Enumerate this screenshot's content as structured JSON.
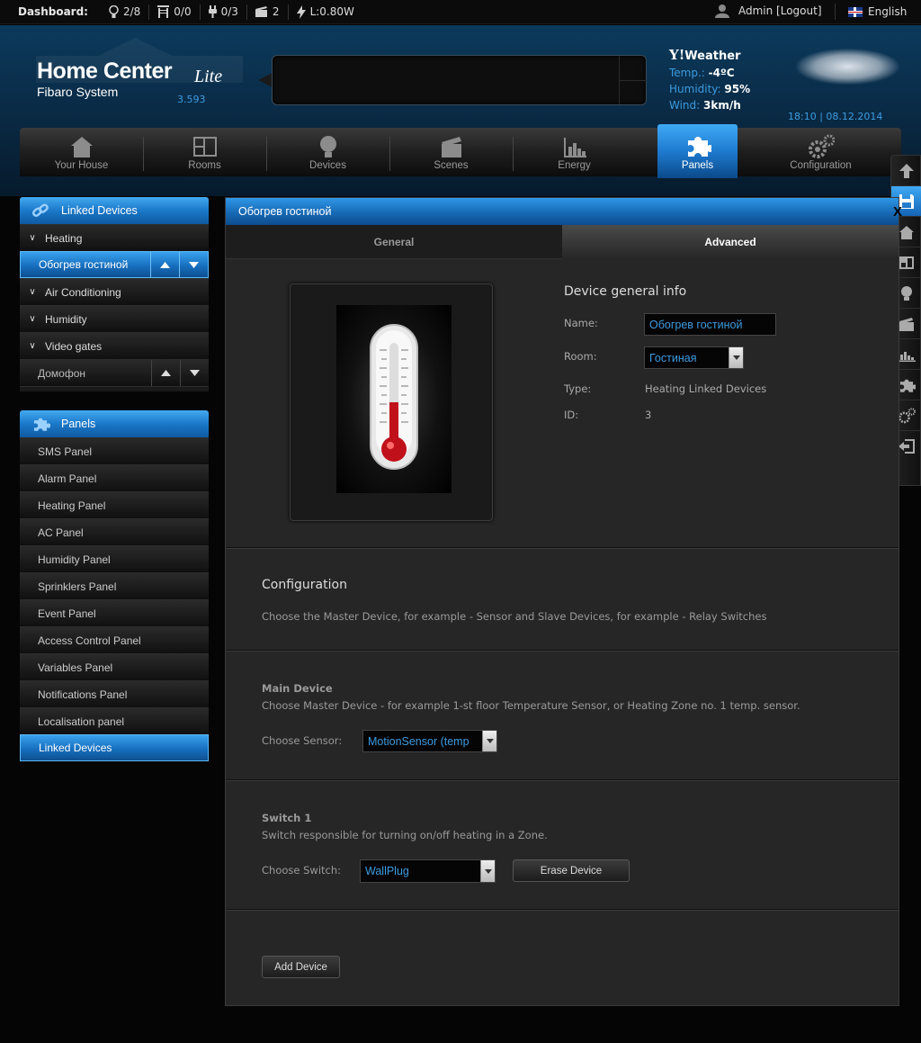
{
  "topbar": {
    "dashboard_label": "Dashboard:",
    "stats": [
      {
        "icon": "bulb-icon",
        "value": "2/8"
      },
      {
        "icon": "blind-icon",
        "value": "0/0"
      },
      {
        "icon": "plug-icon",
        "value": "0/3"
      },
      {
        "icon": "scene-icon",
        "value": "2"
      },
      {
        "icon": "lightning-icon",
        "value": "L:0.80W"
      }
    ],
    "user_text": "Admin [Logout]",
    "language": "English"
  },
  "header": {
    "logo_main": "Home Center",
    "logo_lite": "Lite",
    "logo_sub": "Fibaro System",
    "version": "3.593",
    "weather": {
      "title": "Weather",
      "logo": "Y!",
      "temp_label": "Temp.:",
      "temp_value": "-4ºC",
      "humidity_label": "Humidity:",
      "humidity_value": "95%",
      "wind_label": "Wind:",
      "wind_value": "3km/h"
    },
    "datetime": "18:10 | 08.12.2014"
  },
  "nav": [
    {
      "label": "Your House",
      "icon": "house-icon"
    },
    {
      "label": "Rooms",
      "icon": "rooms-icon"
    },
    {
      "label": "Devices",
      "icon": "bulb-icon"
    },
    {
      "label": "Scenes",
      "icon": "clapper-icon"
    },
    {
      "label": "Energy",
      "icon": "energy-chart-icon"
    },
    {
      "label": "Panels",
      "icon": "puzzle-icon",
      "active": true
    },
    {
      "label": "Configuration",
      "icon": "gears-icon"
    }
  ],
  "right_toolbar": [
    {
      "icon": "arrow-up-icon"
    },
    {
      "icon": "save-icon",
      "active": true
    },
    {
      "icon": "house-icon"
    },
    {
      "icon": "rooms-icon"
    },
    {
      "icon": "bulb-icon"
    },
    {
      "icon": "clapper-icon"
    },
    {
      "icon": "energy-chart-icon"
    },
    {
      "icon": "puzzle-icon"
    },
    {
      "icon": "gears-icon"
    },
    {
      "icon": "logout-icon"
    }
  ],
  "linked_sidebar": {
    "title": "Linked Devices",
    "groups": [
      {
        "label": "Heating"
      },
      {
        "label": "Обогрев гостиной",
        "sub": true,
        "selected": true
      },
      {
        "label": "Air Conditioning"
      },
      {
        "label": "Humidity"
      },
      {
        "label": "Video gates"
      },
      {
        "label": "Домофон",
        "sub": true
      }
    ]
  },
  "panels_sidebar": {
    "title": "Panels",
    "items": [
      "SMS Panel",
      "Alarm Panel",
      "Heating Panel",
      "AC Panel",
      "Humidity Panel",
      "Sprinklers Panel",
      "Event Panel",
      "Access Control Panel",
      "Variables Panel",
      "Notifications Panel",
      "Localisation panel",
      "Linked Devices"
    ],
    "selected_index": 11
  },
  "panel": {
    "title": "Обогрев гостиной",
    "close": "X",
    "tabs": {
      "general": "General",
      "advanced": "Advanced"
    },
    "info": {
      "title": "Device general info",
      "name_label": "Name:",
      "name_value": "Обогрев гостиной",
      "room_label": "Room:",
      "room_value": "Гостиная",
      "type_label": "Type:",
      "type_value": "Heating Linked Devices",
      "id_label": "ID:",
      "id_value": "3"
    },
    "config": {
      "title": "Configuration",
      "desc": "Choose the Master Device, for example - Sensor and Slave Devices, for example - Relay Switches"
    },
    "main_device": {
      "title": "Main Device",
      "desc": "Choose Master Device - for example 1-st floor Temperature Sensor, or Heating Zone no. 1 temp. sensor.",
      "label": "Choose Sensor:",
      "value": "MotionSensor (temp"
    },
    "switch1": {
      "title": "Switch 1",
      "desc": "Switch responsible for turning on/off heating in a Zone.",
      "label": "Choose Switch:",
      "value": "WallPlug",
      "erase": "Erase Device"
    },
    "add_device": "Add Device"
  },
  "colors": {
    "accent": "#1e7bd0",
    "link": "#3c9be0",
    "panel_bg": "#262626"
  }
}
